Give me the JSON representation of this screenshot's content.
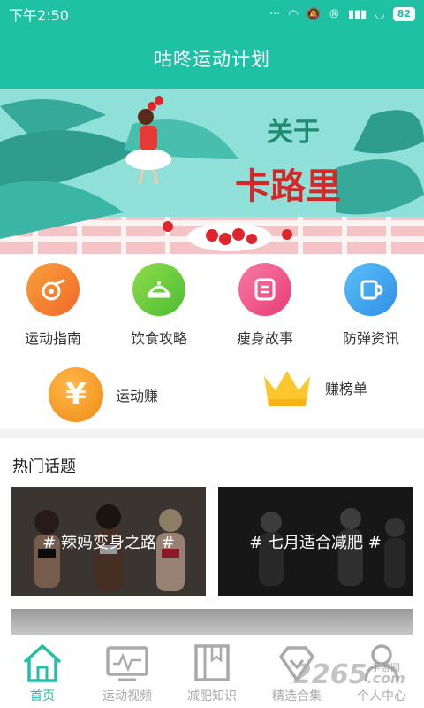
{
  "status": {
    "time": "下午2:50",
    "battery": "82"
  },
  "header": {
    "title": "咕咚运动计划"
  },
  "banner": {
    "line1": "关于",
    "line2": "卡路里"
  },
  "categories": [
    {
      "label": "运动指南",
      "icon": "whistle-icon",
      "color": "#f58a2a"
    },
    {
      "label": "饮食攻略",
      "icon": "food-cover-icon",
      "color": "#6fcf3a"
    },
    {
      "label": "瘦身故事",
      "icon": "note-icon",
      "color": "#f0528a"
    },
    {
      "label": "防弹资讯",
      "icon": "cup-icon",
      "color": "#3aa6f0"
    }
  ],
  "earn": {
    "coin_symbol": "¥",
    "earn_label": "运动赚",
    "rank_label": "赚榜单"
  },
  "hot": {
    "title": "热门话题",
    "topics": [
      "# 辣妈变身之路 #",
      "# 七月适合减肥 #"
    ]
  },
  "nav": [
    {
      "label": "首页",
      "icon": "home-icon",
      "active": true
    },
    {
      "label": "运动视频",
      "icon": "video-monitor-icon",
      "active": false
    },
    {
      "label": "减肥知识",
      "icon": "book-icon",
      "active": false
    },
    {
      "label": "精选合集",
      "icon": "collection-icon",
      "active": false
    },
    {
      "label": "个人中心",
      "icon": "person-icon",
      "active": false
    }
  ],
  "watermark": {
    "text": "2265",
    "suffix": ".com",
    "sub": "手游网"
  }
}
